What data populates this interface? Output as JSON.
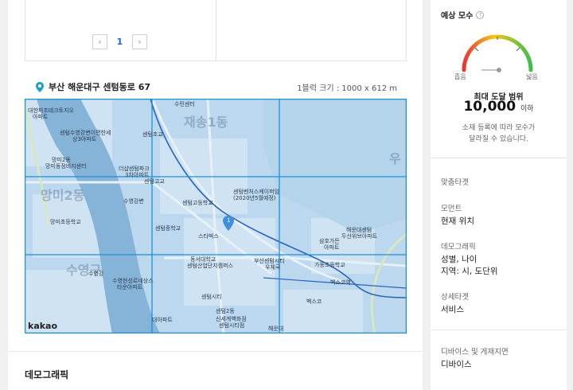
{
  "pager": {
    "prev": "‹",
    "current": "1",
    "next": "›"
  },
  "location": {
    "address": "부산 해운대구 센텀동로 67",
    "block_size": "1블럭 크기 : 1000 x 612 m"
  },
  "map": {
    "logo": "kakao",
    "marker": "1",
    "labels": [
      "수민센터",
      "대한피조테크토지오",
      "아파트",
      "센텀수영강변이편한세",
      "상3아파트",
      "센텀초교",
      "망미2동",
      "망미동정비지센터",
      "더샵센텀파크",
      "3차아파트",
      "재송1동",
      "센텀고교",
      "수영강변",
      "센텀고등학교",
      "센텀벤처스케이퍼임",
      "(2020년5월예정)",
      "망미2동",
      "망미초등학교",
      "센텀중학교",
      "스타벅스",
      "삼호가든",
      "아파트",
      "해운대센텀",
      "두산위브아파트",
      "동서대학교",
      "센텀산업단지캠퍼스",
      "부산센텀시티",
      "우체국",
      "가동초등학교",
      "벡스코역",
      "수영강",
      "수영현성르네상스",
      "타운아파트",
      "센텀시티",
      "벡스코",
      "수영구",
      "대아파트",
      "센텀2동",
      "신세계백화점",
      "센텀시티점",
      "해운대",
      "우"
    ]
  },
  "section_title": "데모그래픽",
  "estimate": {
    "title": "예상 모수",
    "help": "?",
    "narrow": "좁음",
    "wide": "넓음",
    "reach_label": "최대 도달 범위",
    "reach_value": "10,000",
    "reach_unit": "이하",
    "note_line1": "소재 등록에 따라 모수가",
    "note_line2": "달라질 수 있습니다."
  },
  "targeting": {
    "heading": "맞춤타겟",
    "moment_label": "모먼트",
    "moment_value": "현재 위치",
    "demo_label": "데모그래픽",
    "demo_value1": "성별, 나이",
    "demo_value2": "지역: 시, 도단위",
    "detail_label": "상세타겟",
    "detail_value": "서비스",
    "device_label": "디바이스 및 게재지면",
    "device_value": "디바이스"
  },
  "colors": {
    "accent": "#1b64da",
    "grid": "#1e90d6",
    "overlay": "#8ec1e8"
  }
}
